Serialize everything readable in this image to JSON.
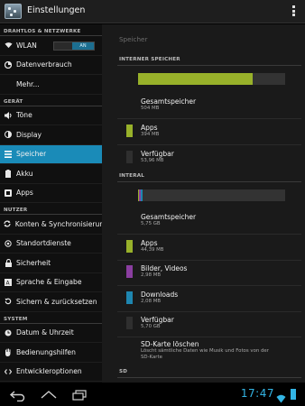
{
  "app": {
    "title": "Einstellungen"
  },
  "colors": {
    "accent": "#1a8bb8",
    "apps": "#98b12a",
    "free": "#2f2f2f",
    "pictures": "#8a3ea0",
    "downloads": "#1e86b0",
    "clock": "#33b5e5"
  },
  "sidebar": {
    "sections": [
      {
        "header": "DRAHTLOS & NETZWERKE",
        "items": [
          {
            "label": "WLAN",
            "icon": "wifi-icon",
            "toggle": "AN"
          },
          {
            "label": "Datenverbrauch",
            "icon": "data-usage-icon"
          },
          {
            "label": "Mehr...",
            "icon": ""
          }
        ]
      },
      {
        "header": "GERÄT",
        "items": [
          {
            "label": "Töne",
            "icon": "volume-icon"
          },
          {
            "label": "Display",
            "icon": "brightness-icon"
          },
          {
            "label": "Speicher",
            "icon": "storage-icon",
            "active": true
          },
          {
            "label": "Akku",
            "icon": "battery-icon"
          },
          {
            "label": "Apps",
            "icon": "apps-icon"
          }
        ]
      },
      {
        "header": "NUTZER",
        "items": [
          {
            "label": "Konten & Synchronisierung",
            "icon": "sync-icon"
          },
          {
            "label": "Standortdienste",
            "icon": "location-icon"
          },
          {
            "label": "Sicherheit",
            "icon": "lock-icon"
          },
          {
            "label": "Sprache & Eingabe",
            "icon": "language-icon"
          },
          {
            "label": "Sichern & zurücksetzen",
            "icon": "backup-icon"
          }
        ]
      },
      {
        "header": "SYSTEM",
        "items": [
          {
            "label": "Datum & Uhrzeit",
            "icon": "clock-icon"
          },
          {
            "label": "Bedienungshilfen",
            "icon": "accessibility-icon"
          },
          {
            "label": "Entwickleroptionen",
            "icon": "developer-icon"
          }
        ]
      }
    ]
  },
  "storage": {
    "title": "Speicher",
    "internal": {
      "header": "INTERNER SPEICHER",
      "bar": {
        "apps_fraction": 0.78
      },
      "rows": [
        {
          "title": "Gesamtspeicher",
          "value": "504 MB"
        },
        {
          "title": "Apps",
          "value": "394 MB",
          "swatch": "apps"
        },
        {
          "title": "Verfügbar",
          "value": "53,96 MB",
          "swatch": "free"
        }
      ]
    },
    "interal": {
      "header": "INTERAL",
      "bar": {
        "segments": [
          {
            "color": "apps",
            "fraction": 0.008
          },
          {
            "color": "pictures",
            "fraction": 0.012
          },
          {
            "color": "downloads",
            "fraction": 0.012
          }
        ]
      },
      "rows": [
        {
          "title": "Gesamtspeicher",
          "value": "5,75 GB"
        },
        {
          "title": "Apps",
          "value": "44,39 MB",
          "swatch": "apps"
        },
        {
          "title": "Bilder, Videos",
          "value": "2,98 MB",
          "swatch": "pictures"
        },
        {
          "title": "Downloads",
          "value": "2,08 MB",
          "swatch": "downloads"
        },
        {
          "title": "Verfügbar",
          "value": "5,70 GB",
          "swatch": "free"
        },
        {
          "title": "SD-Karte löschen",
          "value": "Löscht sämtliche Daten wie Musik und Fotos von der SD-Karte"
        }
      ]
    },
    "sd_header": "SD"
  },
  "statusbar": {
    "time": "17:47"
  }
}
